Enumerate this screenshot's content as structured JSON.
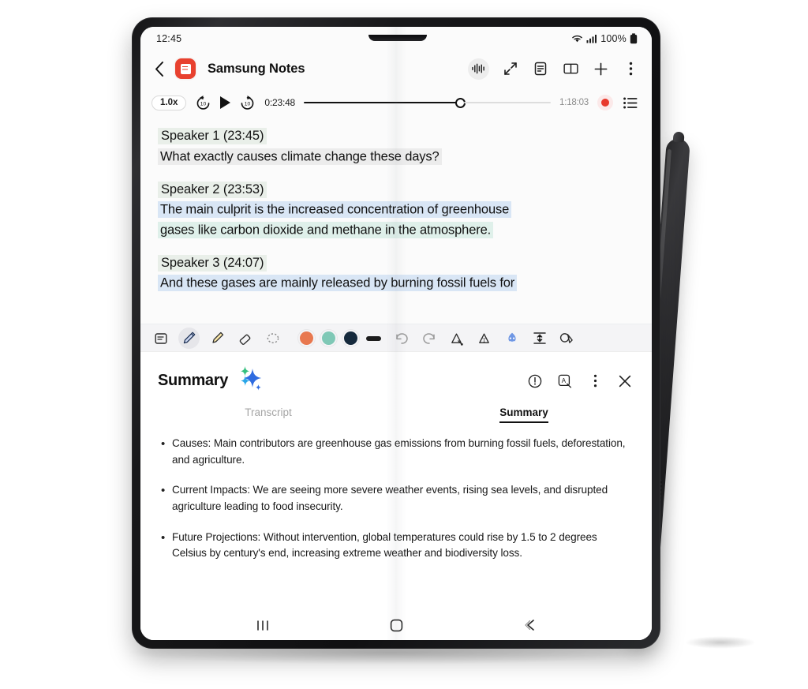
{
  "device": {
    "name": "samsung-galaxy-z-fold",
    "accessory": "s-pen"
  },
  "status_bar": {
    "time": "12:45",
    "battery": "100%",
    "wifi_icon": "wifi-icon",
    "signal_icon": "cellular-signal-icon",
    "battery_icon": "battery-full-icon"
  },
  "app_bar": {
    "back_icon": "back-chevron-icon",
    "app_icon": "samsung-notes-app-icon",
    "title": "Samsung Notes",
    "icons": [
      {
        "name": "voice-recording-icon",
        "selected": true
      },
      {
        "name": "expand-diagonal-icon",
        "selected": false
      },
      {
        "name": "note-list-icon",
        "selected": false
      },
      {
        "name": "book-view-icon",
        "selected": false
      },
      {
        "name": "add-icon",
        "selected": false
      },
      {
        "name": "more-options-icon",
        "selected": false
      }
    ]
  },
  "player": {
    "speed": "1.0x",
    "rewind_label": "10",
    "forward_label": "10",
    "play_icon": "play-icon",
    "current_time": "0:23:48",
    "total_time": "1:18:03",
    "progress_percent": 62,
    "record_icon": "record-icon",
    "list_icon": "transcript-list-icon"
  },
  "transcript": {
    "entries": [
      {
        "speaker": "Speaker 1",
        "time": "(23:45)",
        "lines": [
          {
            "text": "What exactly causes climate change these days?",
            "highlight": "hl-grey"
          }
        ]
      },
      {
        "speaker": "Speaker 2",
        "time": "(23:53)",
        "lines": [
          {
            "text": "The main culprit is the increased concentration of greenhouse",
            "highlight": "hl-blue"
          },
          {
            "text": "gases like carbon dioxide and methane in the atmosphere.",
            "highlight": "hl-mint"
          }
        ]
      },
      {
        "speaker": "Speaker 3",
        "time": "(24:07)",
        "lines": [
          {
            "text": "And these gases are mainly released by burning fossil fuels for",
            "highlight": "hl-blue"
          }
        ]
      }
    ]
  },
  "pen_toolbar": {
    "tools": [
      {
        "name": "text-box-tool",
        "active": false
      },
      {
        "name": "pen-tool",
        "active": true
      },
      {
        "name": "highlighter-tool",
        "active": false
      },
      {
        "name": "eraser-tool",
        "active": false
      },
      {
        "name": "lasso-select-tool",
        "active": false
      }
    ],
    "colors": [
      {
        "name": "color-swatch-orange",
        "hex": "#E8784F"
      },
      {
        "name": "color-swatch-mint",
        "hex": "#7FC8B6"
      },
      {
        "name": "color-swatch-navy",
        "hex": "#15293C"
      }
    ],
    "stroke_width_name": "stroke-width-swatch",
    "actions": [
      {
        "name": "undo-icon"
      },
      {
        "name": "redo-icon"
      },
      {
        "name": "shape-recognition-icon"
      },
      {
        "name": "text-conversion-icon"
      },
      {
        "name": "ai-assist-icon",
        "accent": "#4b7ee8"
      },
      {
        "name": "text-align-icon"
      },
      {
        "name": "ink-select-icon"
      }
    ]
  },
  "summary_panel": {
    "title": "Summary",
    "sparkle_icon": "ai-sparkle-icon",
    "actions": [
      {
        "name": "info-icon"
      },
      {
        "name": "copy-translate-icon"
      },
      {
        "name": "more-options-icon"
      },
      {
        "name": "close-icon"
      }
    ],
    "tabs": [
      {
        "label": "Transcript",
        "active": false
      },
      {
        "label": "Summary",
        "active": true
      }
    ],
    "bullets": [
      "Causes: Main contributors are greenhouse gas emissions from burning fossil fuels, deforestation, and agriculture.",
      "Current Impacts: We are seeing more severe weather events, rising sea levels, and disrupted agriculture leading to food insecurity.",
      "Future Projections: Without intervention, global temperatures could rise by 1.5 to 2 degrees Celsius by century's end, increasing extreme weather and biodiversity loss."
    ],
    "bullet_marker": "•"
  },
  "nav_bar": {
    "recents_icon": "recent-apps-icon",
    "home_icon": "home-icon",
    "back_icon": "back-icon"
  }
}
